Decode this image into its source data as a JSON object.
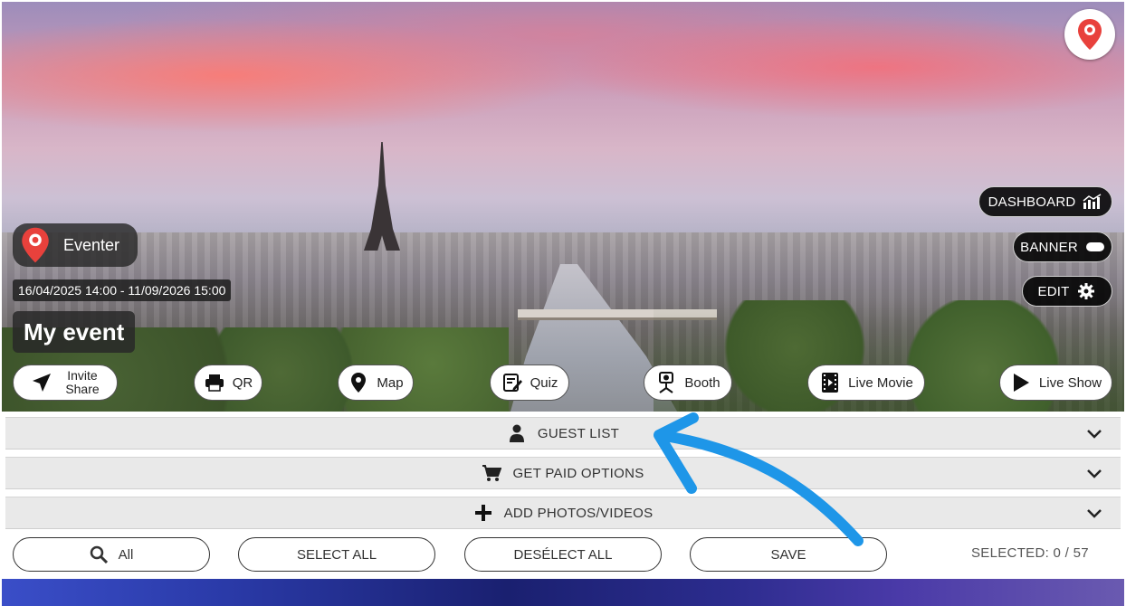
{
  "event": {
    "brand": "Eventer",
    "dates": "16/04/2025 14:00 - 11/09/2026 15:00",
    "title": "My event"
  },
  "admin_buttons": {
    "dashboard": "DASHBOARD",
    "banner": "BANNER",
    "edit": "EDIT"
  },
  "actions": {
    "invite_line1": "Invite",
    "invite_line2": "Share",
    "qr": "QR",
    "map": "Map",
    "quiz": "Quiz",
    "booth": "Booth",
    "live_movie": "Live Movie",
    "live_show": "Live Show"
  },
  "accordion": {
    "guest_list": "GUEST LIST",
    "get_paid": "GET PAID OPTIONS",
    "add_media": "ADD PHOTOS/VIDEOS"
  },
  "toolbar": {
    "filter": "All",
    "select_all": "SELECT ALL",
    "deselect_all": "DESÉLECT ALL",
    "save": "SAVE",
    "selected_count": "SELECTED: 0 / 57"
  },
  "colors": {
    "brand_red": "#e8413c",
    "annotation_arrow": "#1e96e8"
  },
  "icons": [
    "location-pin-icon",
    "bar-chart-icon",
    "toggle-icon",
    "gear-icon",
    "send-icon",
    "printer-icon",
    "map-pin-icon",
    "quiz-icon",
    "camera-booth-icon",
    "film-icon",
    "play-icon",
    "user-icon",
    "cart-icon",
    "plus-icon",
    "chevron-down-icon",
    "search-icon"
  ]
}
